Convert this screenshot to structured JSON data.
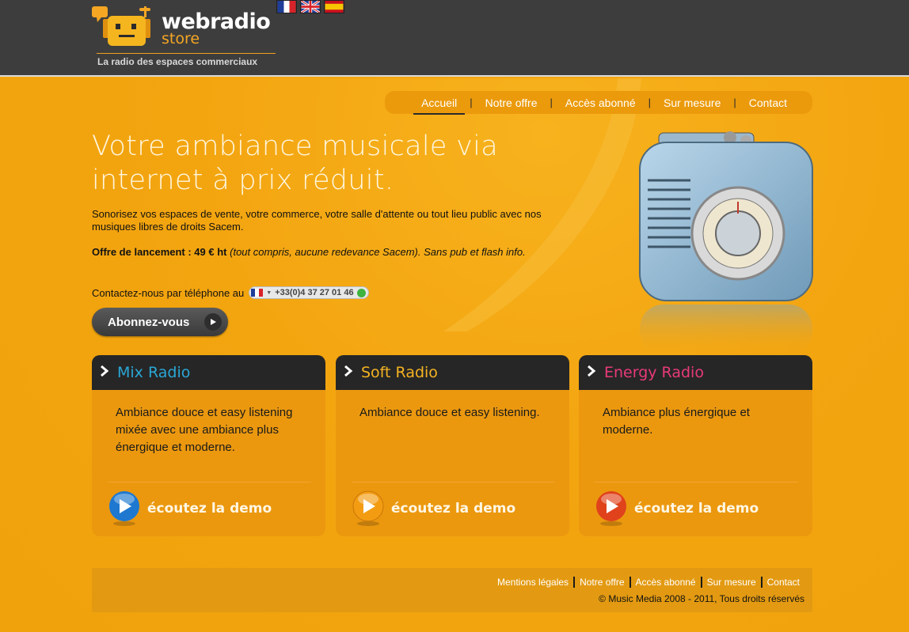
{
  "header": {
    "logo_word": "webradio",
    "logo_sub": "store",
    "tagline": "La radio des espaces commerciaux",
    "flags": [
      {
        "name": "flag-france",
        "lang": "fr"
      },
      {
        "name": "flag-uk",
        "lang": "en"
      },
      {
        "name": "flag-spain",
        "lang": "es"
      }
    ]
  },
  "nav": {
    "items": [
      {
        "label": "Accueil",
        "active": true
      },
      {
        "label": "Notre offre"
      },
      {
        "label": "Accès abonné"
      },
      {
        "label": "Sur mesure"
      },
      {
        "label": "Contact"
      }
    ]
  },
  "hero": {
    "title": "Votre ambiance musicale via internet à prix réduit.",
    "text": "Sonorisez vos espaces de vente, votre commerce, votre salle d'attente ou tout lieu public avec nos musiques libres de droits Sacem.",
    "offer_bold": "Offre de lancement : 49 € ht",
    "offer_italic": "(tout compris, aucune redevance Sacem). Sans pub et flash info.",
    "phone_label": "Contactez-nous par téléphone au",
    "phone_number": "+33(0)4 37 27 01 46",
    "subscribe_label": "Abonnez-vous"
  },
  "cards": [
    {
      "title": "Mix Radio",
      "title_color": "#2aa7d6",
      "text": "Ambiance douce et easy listening mixée avec une ambiance plus énergique et moderne.",
      "demo": "écoutez la demo",
      "orb_color": "#1e78d0"
    },
    {
      "title": "Soft Radio",
      "title_color": "#f5b321",
      "text": "Ambiance douce et easy listening.",
      "demo": "écoutez la demo",
      "orb_color": "#f39c12"
    },
    {
      "title": "Energy Radio",
      "title_color": "#e83a78",
      "text": "Ambiance plus énergique et moderne.",
      "demo": "écoutez la demo",
      "orb_color": "#e0421c"
    }
  ],
  "footer": {
    "links": [
      "Mentions légales",
      "Notre offre",
      "Accès abonné",
      "Sur mesure",
      "Contact"
    ],
    "copyright": "© Music Media 2008 - 2011, Tous droits réservés"
  },
  "colors": {
    "header_bg": "#3d3d3d",
    "page_bg": "#f3a510",
    "card_head_bg": "#262626"
  }
}
